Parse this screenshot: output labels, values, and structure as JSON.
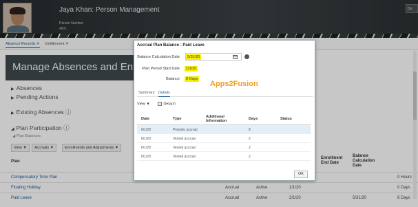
{
  "header": {
    "title": "Jaya Khan: Person Management",
    "person_number_label": "Person Number",
    "person_number_value": "4601",
    "right_button": "Do"
  },
  "tabs": [
    {
      "label": "Absence Records ✕"
    },
    {
      "label": "Entitlement ✕"
    }
  ],
  "page_title": "Manage Absences and Entitlements",
  "sections": {
    "absences": "Absences",
    "pending_actions": "Pending Actions",
    "existing_absences": "Existing Absences",
    "plan_participation": "Plan Participation",
    "plan_balances": "Plan Balances"
  },
  "toolbar": {
    "view": "View ▼",
    "accruals": "Accruals ▼",
    "enrollments": "Enrollments and Adjustments ▼"
  },
  "bg_table": {
    "headers": {
      "plan": "Plan",
      "enrollment_end": "Enrollment End Date",
      "balance_calc": "Balance Calculation Date"
    },
    "rows": [
      {
        "plan": "Compensatory Time Plan",
        "type": "",
        "status": "",
        "start": "",
        "calc": "",
        "balance": "0 Hours"
      },
      {
        "plan": "Floating Holiday",
        "type": "Accrual",
        "status": "Active",
        "start": "1/1/20",
        "calc": "",
        "balance": "0 Days"
      },
      {
        "plan": "Paid Leave",
        "type": "Accrual",
        "status": "Active",
        "start": "2/1/20",
        "calc": "5/31/20",
        "balance": "8 Days"
      }
    ]
  },
  "modal": {
    "title": "Accrual Plan Balance : Paid Leave",
    "calc_date_label": "Balance Calculation Date",
    "calc_date_value": "5/31/20",
    "start_date_label": "Plan Period Start Date",
    "start_date_value": "1/1/20",
    "balance_label": "Balance",
    "balance_value": "8 Days",
    "watermark": "Apps2Fusion",
    "tabs": [
      "Summary",
      "Details"
    ],
    "view": "View ▼",
    "detach": "Detach",
    "columns": [
      "Date",
      "Type",
      "Additional Information",
      "Days",
      "Status"
    ],
    "rows": [
      {
        "date": "6/1/20",
        "type": "Periodic accrual",
        "info": "",
        "days": "8",
        "status": ""
      },
      {
        "date": "6/1/20",
        "type": "Vested accrual",
        "info": "",
        "days": "2",
        "status": ""
      },
      {
        "date": "6/1/20",
        "type": "Vested accrual",
        "info": "",
        "days": "2",
        "status": ""
      },
      {
        "date": "6/1/20",
        "type": "Vested accrual",
        "info": "",
        "days": "2",
        "status": ""
      }
    ],
    "ok": "OK"
  }
}
